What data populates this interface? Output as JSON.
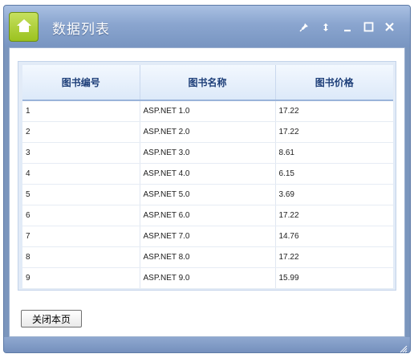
{
  "window": {
    "title": "数据列表",
    "controls": [
      "pin-icon",
      "restore-icon",
      "minimize-icon",
      "maximize-icon",
      "close-icon"
    ]
  },
  "table": {
    "headers": [
      "图书编号",
      "图书名称",
      "图书价格"
    ],
    "rows": [
      [
        "1",
        "ASP.NET 1.0",
        "17.22"
      ],
      [
        "2",
        "ASP.NET 2.0",
        "17.22"
      ],
      [
        "3",
        "ASP.NET 3.0",
        "8.61"
      ],
      [
        "4",
        "ASP.NET 4.0",
        "6.15"
      ],
      [
        "5",
        "ASP.NET 5.0",
        "3.69"
      ],
      [
        "6",
        "ASP.NET 6.0",
        "17.22"
      ],
      [
        "7",
        "ASP.NET 7.0",
        "14.76"
      ],
      [
        "8",
        "ASP.NET 8.0",
        "17.22"
      ],
      [
        "9",
        "ASP.NET 9.0",
        "15.99"
      ]
    ]
  },
  "footer": {
    "close_button_label": "关闭本页"
  },
  "colors": {
    "titlebar": "#8aa5cf",
    "home_button": "#a7cb2e",
    "header_text": "#1e3f79"
  }
}
